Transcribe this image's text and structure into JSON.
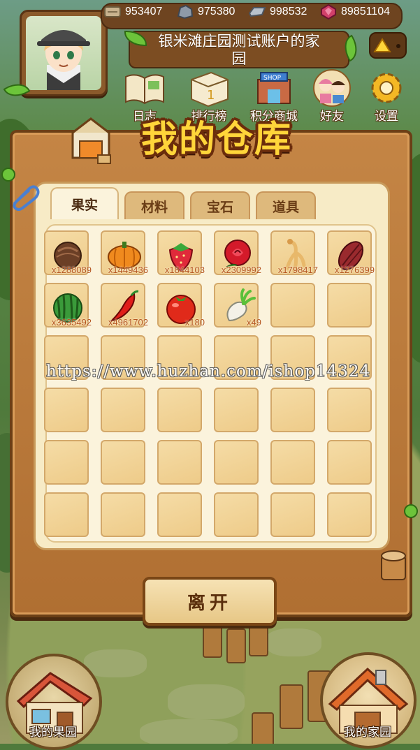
{
  "resources": [
    {
      "icon": "wood-plank-icon",
      "value": "953407"
    },
    {
      "icon": "stone-ore-icon",
      "value": "975380"
    },
    {
      "icon": "metal-bar-icon",
      "value": "998532"
    },
    {
      "icon": "ruby-gem-icon",
      "value": "89851104"
    }
  ],
  "home_title": {
    "line1": "银米滩庄园测试账户的家",
    "line2": "园"
  },
  "nav": [
    {
      "id": "journal",
      "label": "日志",
      "icon": "journal-book-icon"
    },
    {
      "id": "ranking",
      "label": "排行榜",
      "icon": "leaderboard-icon"
    },
    {
      "id": "shop",
      "label": "积分商城",
      "icon": "points-shop-icon"
    },
    {
      "id": "friends",
      "label": "好友",
      "icon": "friends-icon"
    },
    {
      "id": "settings",
      "label": "设置",
      "icon": "gear-icon"
    }
  ],
  "warehouse": {
    "title": "我的仓库",
    "tabs": [
      {
        "label": "果实",
        "active": true
      },
      {
        "label": "材料",
        "active": false
      },
      {
        "label": "宝石",
        "active": false
      },
      {
        "label": "道具",
        "active": false
      }
    ],
    "items": [
      {
        "name": "coconut",
        "icon": "coconut-icon",
        "count": "x1288089"
      },
      {
        "name": "pumpkin",
        "icon": "pumpkin-icon",
        "count": "x1449436"
      },
      {
        "name": "strawberry",
        "icon": "strawberry-icon",
        "count": "x1844103"
      },
      {
        "name": "rose",
        "icon": "rose-icon",
        "count": "x2309992"
      },
      {
        "name": "ginseng",
        "icon": "ginseng-icon",
        "count": "x1798417"
      },
      {
        "name": "cocoa",
        "icon": "cocoa-pod-icon",
        "count": "x1276399"
      },
      {
        "name": "watermelon",
        "icon": "watermelon-icon",
        "count": "x3635492"
      },
      {
        "name": "chili",
        "icon": "chili-pepper-icon",
        "count": "x4961702"
      },
      {
        "name": "tomato",
        "icon": "tomato-icon",
        "count": "x180"
      },
      {
        "name": "radish",
        "icon": "radish-icon",
        "count": "x49"
      }
    ],
    "leave_label": "离开"
  },
  "watermark": "https://www.huzhan.com/ishop14324",
  "bottom": {
    "orchard_label": "我的果园",
    "home_label": "我的家园"
  },
  "colors": {
    "accent_gold": "#ffd53a",
    "panel_wood": "#b06f32",
    "slot_bg": "#f0d192",
    "count_text": "#b5561e"
  }
}
